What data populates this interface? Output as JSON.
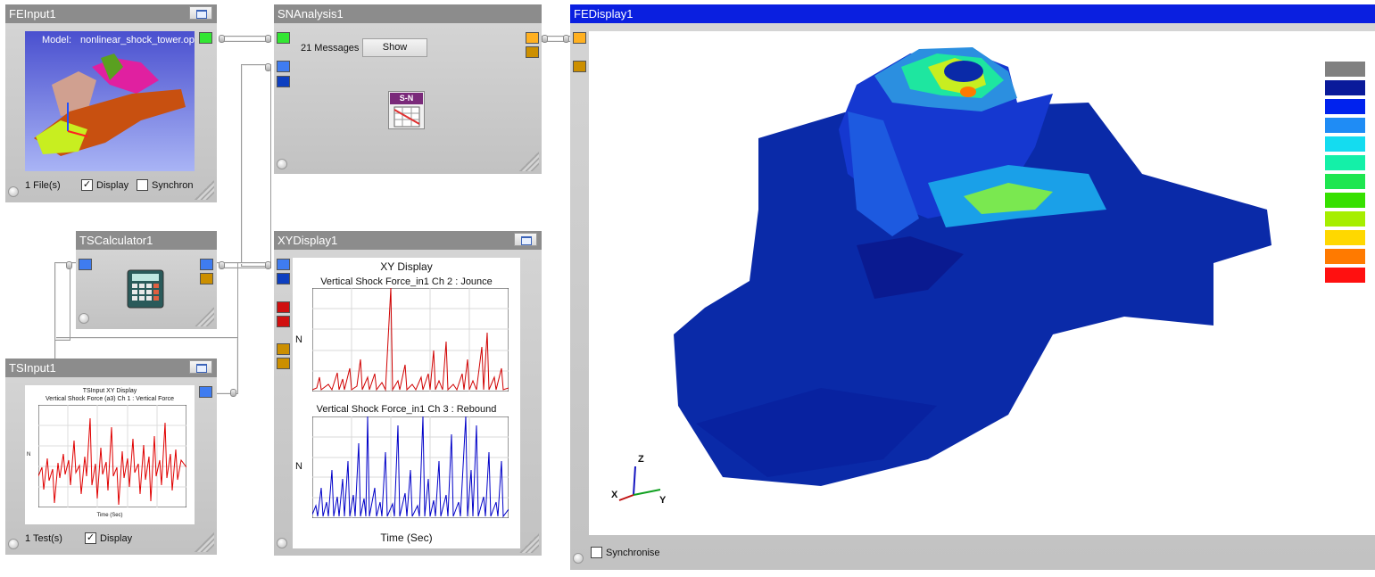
{
  "fe_input": {
    "title": "FEInput1",
    "model_label": "Model:",
    "model_name": "nonlinear_shock_tower.op",
    "files": "1 File(s)",
    "display_label": "Display",
    "display_checked": "✓",
    "sync_label": "Synchron"
  },
  "sn_analysis": {
    "title": "SNAnalysis1",
    "messages": "21 Messages",
    "show_label": "Show",
    "icon_text": "S-N"
  },
  "ts_calculator": {
    "title": "TSCalculator1"
  },
  "xy_display": {
    "title": "XYDisplay1",
    "header": "XY Display",
    "plot1_title": "Vertical Shock Force_in1  Ch 2 : Jounce",
    "plot2_title": "Vertical Shock Force_in1  Ch 3 : Rebound",
    "y_label": "N",
    "x_label": "Time (Sec)"
  },
  "ts_input": {
    "title": "TSInput1",
    "header": "TSInput XY Display",
    "plot_title": "Vertical Shock Force (a3)  Ch 1 : Vertical Force",
    "y_label": "N",
    "x_label": "Time (Sec)",
    "tests": "1 Test(s)",
    "display_label": "Display",
    "display_checked": "✓"
  },
  "fe_display": {
    "title": "FEDisplay1",
    "sync_label": "Synchronise",
    "axis_z": "Z",
    "axis_y": "Y",
    "axis_x": "X",
    "legend_colors": [
      "#808080",
      "#0a1a9a",
      "#0022ee",
      "#1f8cf5",
      "#14dcf0",
      "#14f0a8",
      "#1ee650",
      "#36e000",
      "#a6ee00",
      "#ffd800",
      "#ff7a00",
      "#ff1010"
    ]
  },
  "colors": {
    "title_bar": "#8c8c8c",
    "active_title_bar": "#0a1fe0",
    "jounce_trace": "#d00000",
    "rebound_trace": "#0000c8"
  }
}
